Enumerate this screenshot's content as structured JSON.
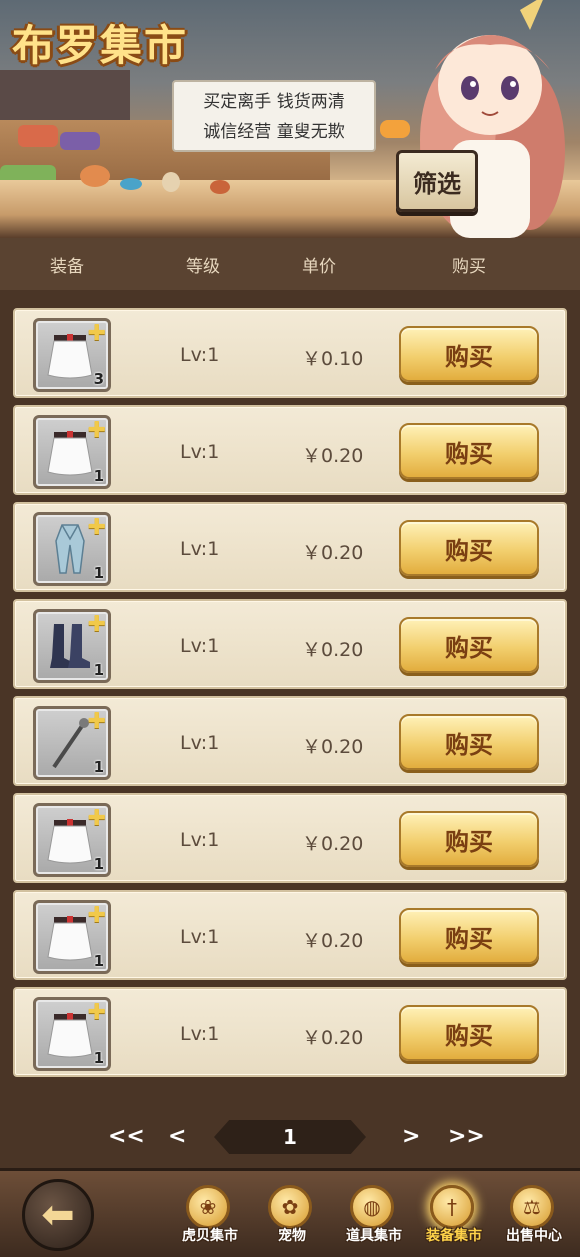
{
  "header": {
    "title": "布罗集市",
    "slogan_line1": "买定离手 钱货两清",
    "slogan_line2": "诚信经营 童叟无欺",
    "filter_label": "筛选"
  },
  "columns": {
    "equipment": "装备",
    "level": "等级",
    "price": "单价",
    "buy": "购买"
  },
  "items": [
    {
      "icon": "white-skirt-icon",
      "count": "3",
      "level": "Lv:1",
      "price": "￥0.10",
      "buy_label": "购买"
    },
    {
      "icon": "white-skirt-icon",
      "count": "1",
      "level": "Lv:1",
      "price": "￥0.20",
      "buy_label": "购买"
    },
    {
      "icon": "blue-robe-icon",
      "count": "1",
      "level": "Lv:1",
      "price": "￥0.20",
      "buy_label": "购买"
    },
    {
      "icon": "dark-boots-icon",
      "count": "1",
      "level": "Lv:1",
      "price": "￥0.20",
      "buy_label": "购买"
    },
    {
      "icon": "staff-icon",
      "count": "1",
      "level": "Lv:1",
      "price": "￥0.20",
      "buy_label": "购买"
    },
    {
      "icon": "white-skirt-icon",
      "count": "1",
      "level": "Lv:1",
      "price": "￥0.20",
      "buy_label": "购买"
    },
    {
      "icon": "white-skirt-icon",
      "count": "1",
      "level": "Lv:1",
      "price": "￥0.20",
      "buy_label": "购买"
    },
    {
      "icon": "white-skirt-icon",
      "count": "1",
      "level": "Lv:1",
      "price": "￥0.20",
      "buy_label": "购买"
    }
  ],
  "pagination": {
    "first": "<<",
    "prev": "<",
    "page": "1",
    "next": ">",
    "last": ">>"
  },
  "bottom_nav": [
    {
      "label": "虎贝集市",
      "icon": "paw-coin-icon",
      "active": false
    },
    {
      "label": "宠物",
      "icon": "paw-icon",
      "active": false
    },
    {
      "label": "道具集市",
      "icon": "bag-icon",
      "active": false
    },
    {
      "label": "装备集市",
      "icon": "sword-icon",
      "active": true
    },
    {
      "label": "出售中心",
      "icon": "scale-icon",
      "active": false
    }
  ],
  "colors": {
    "accent_gold": "#f2cf6e",
    "panel_bg": "#4a3526",
    "row_bg": "#f3ead6"
  }
}
